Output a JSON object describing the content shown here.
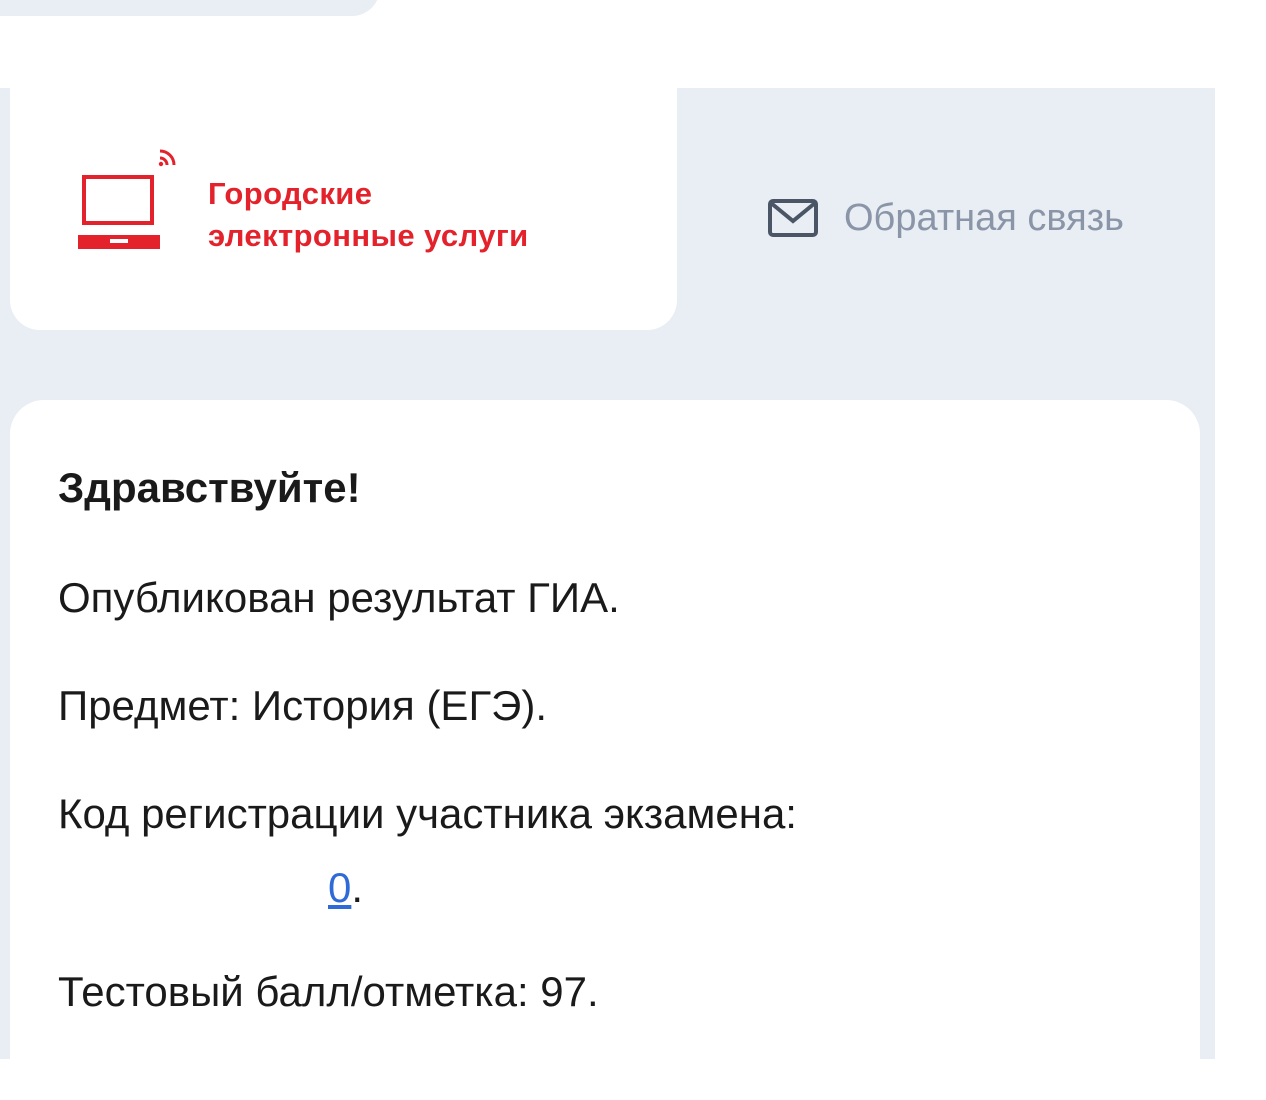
{
  "header": {
    "logo": {
      "line1": "Городские",
      "line2": "электронные услуги",
      "brand_color": "#e3222b"
    },
    "feedback": {
      "label": "Обратная связь",
      "icon": "mail-icon"
    }
  },
  "message": {
    "greeting": "Здравствуйте!",
    "published": "Опубликован результат ГИА.",
    "subject": "Предмет: История (ЕГЭ).",
    "registration_code_label": "Код регистрации участника экзамена:",
    "registration_code_value": "0",
    "registration_code_suffix": ".",
    "score": "Тестовый балл/отметка: 97."
  },
  "colors": {
    "frame_background": "#e9edf4",
    "link": "#2f6bd8",
    "muted_text": "#8a96a8"
  }
}
